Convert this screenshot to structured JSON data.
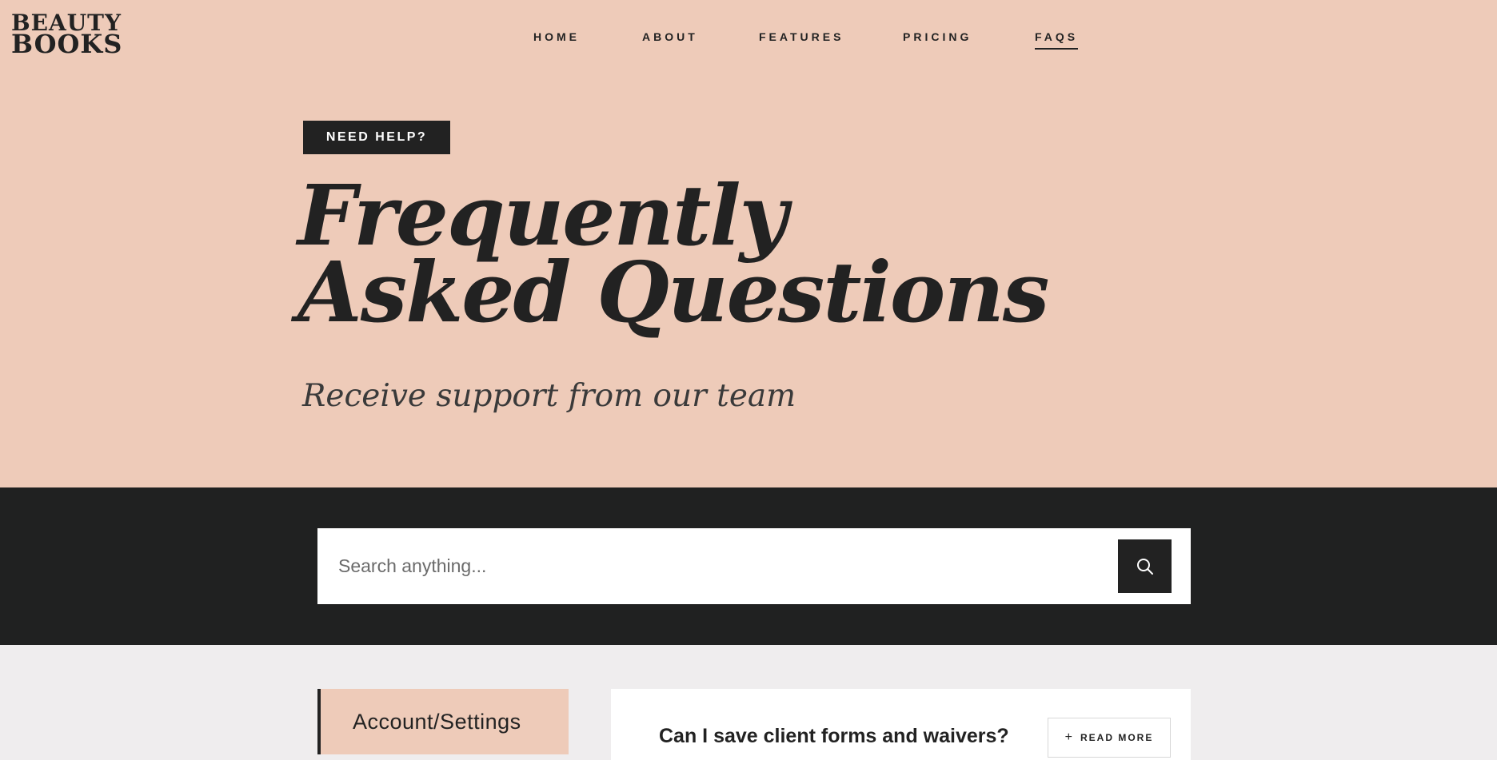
{
  "brand": {
    "line1": "BEAUTY",
    "line2": "BOOKS"
  },
  "nav": {
    "items": [
      {
        "label": "HOME"
      },
      {
        "label": "ABOUT"
      },
      {
        "label": "FEATURES"
      },
      {
        "label": "PRICING"
      },
      {
        "label": "FAQS",
        "active": true
      }
    ]
  },
  "hero": {
    "badge": "NEED HELP?",
    "title_line1": "Frequently",
    "title_line2": "Asked Questions",
    "subtitle": "Receive support from our team"
  },
  "search": {
    "placeholder": "Search anything...",
    "icon": "search-icon"
  },
  "categories": [
    {
      "label": "Account/Settings",
      "active": true
    }
  ],
  "faqs": [
    {
      "question": "Can I save client forms and waivers?",
      "read_more_label": "READ MORE",
      "icon": "plus-icon"
    }
  ],
  "colors": {
    "hero_bg": "#eecbb9",
    "dark": "#222222",
    "search_band": "#202121",
    "content_bg": "#efedee"
  }
}
